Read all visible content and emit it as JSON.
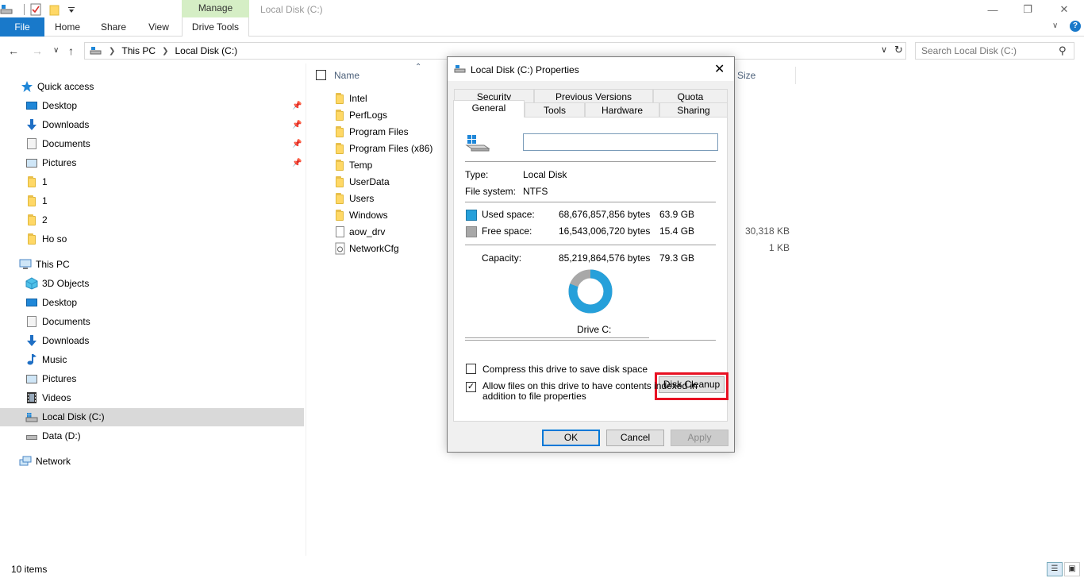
{
  "window": {
    "title": "Local Disk (C:)",
    "context_tab_group": "Manage"
  },
  "ribbon": {
    "tabs": [
      "File",
      "Home",
      "Share",
      "View",
      "Drive Tools"
    ]
  },
  "address": {
    "crumbs": [
      "This PC",
      "Local Disk (C:)"
    ],
    "search_placeholder": "Search Local Disk (C:)"
  },
  "nav": {
    "quick_access": "Quick access",
    "quick_items": [
      "Desktop",
      "Downloads",
      "Documents",
      "Pictures",
      "1",
      "1",
      "2",
      "Ho so"
    ],
    "this_pc": "This PC",
    "pc_items": [
      "3D Objects",
      "Desktop",
      "Documents",
      "Downloads",
      "Music",
      "Pictures",
      "Videos",
      "Local Disk (C:)",
      "Data (D:)"
    ],
    "network": "Network"
  },
  "files": {
    "col_name": "Name",
    "col_size": "Size",
    "items": [
      {
        "name": "Intel",
        "type": "folder",
        "size": ""
      },
      {
        "name": "PerfLogs",
        "type": "folder",
        "size": ""
      },
      {
        "name": "Program Files",
        "type": "folder",
        "size": ""
      },
      {
        "name": "Program Files (x86)",
        "type": "folder",
        "size": ""
      },
      {
        "name": "Temp",
        "type": "folder",
        "size": ""
      },
      {
        "name": "UserData",
        "type": "folder",
        "size": ""
      },
      {
        "name": "Users",
        "type": "folder",
        "size": ""
      },
      {
        "name": "Windows",
        "type": "folder",
        "size": ""
      },
      {
        "name": "aow_drv",
        "type": "file",
        "size": "30,318 KB"
      },
      {
        "name": "NetworkCfg",
        "type": "file",
        "size": "1 KB"
      }
    ]
  },
  "status": {
    "items_count": "10 items"
  },
  "dialog": {
    "title": "Local Disk (C:) Properties",
    "tabs_top": [
      "Security",
      "Previous Versions",
      "Quota"
    ],
    "tabs_bottom": [
      "General",
      "Tools",
      "Hardware",
      "Sharing"
    ],
    "name_value": "",
    "type_label": "Type:",
    "type_value": "Local Disk",
    "fs_label": "File system:",
    "fs_value": "NTFS",
    "used_label": "Used space:",
    "used_bytes": "68,676,857,856 bytes",
    "used_gb": "63.9 GB",
    "free_label": "Free space:",
    "free_bytes": "16,543,006,720 bytes",
    "free_gb": "15.4 GB",
    "cap_label": "Capacity:",
    "cap_bytes": "85,219,864,576 bytes",
    "cap_gb": "79.3 GB",
    "used_fraction": 0.806,
    "used_color": "#26a0da",
    "free_color": "#a8a8a8",
    "drive_label": "Drive C:",
    "disk_cleanup": "Disk Cleanup",
    "compress_label": "Compress this drive to save disk space",
    "compress_checked": false,
    "index_label": "Allow files on this drive to have contents indexed in addition to file properties",
    "index_checked": true,
    "ok": "OK",
    "cancel": "Cancel",
    "apply": "Apply",
    "highlight_color": "#e81123"
  }
}
